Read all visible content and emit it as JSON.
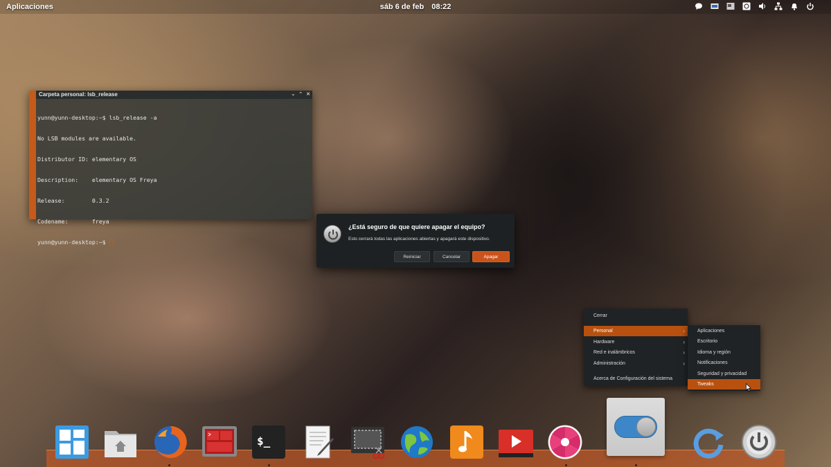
{
  "top_panel": {
    "apps_label": "Aplicaciones",
    "date": "sáb  6 de feb",
    "time": "08:22",
    "indicators": [
      "chat-icon",
      "keyboard-icon",
      "screenshot-icon",
      "steam-icon",
      "volume-icon",
      "network-icon",
      "notifications-icon",
      "power-icon"
    ]
  },
  "terminal": {
    "title": "Carpeta personal: lsb_release",
    "lines": [
      "yunn@yunn-desktop:~$ lsb_release -a",
      "No LSB modules are available.",
      "Distributor ID:\telementary OS",
      "Description:\telementary OS Freya",
      "Release:\t0.3.2",
      "Codename:\tfreya"
    ],
    "prompt": "yunn@yunn-desktop:~$ "
  },
  "shutdown_dialog": {
    "title": "¿Está seguro de que quiere apagar el equipo?",
    "message": "Esto cerrará todas las aplicaciones abiertas y apagará este dispositivo.",
    "restart_label": "Reiniciar",
    "cancel_label": "Cancelar",
    "shutdown_label": "Apagar"
  },
  "context_menu": {
    "items": [
      {
        "label": "Cerrar",
        "submenu": false
      },
      {
        "label": "Personal",
        "submenu": true,
        "active": true
      },
      {
        "label": "Hardware",
        "submenu": true
      },
      {
        "label": "Red e inalámbricos",
        "submenu": true
      },
      {
        "label": "Administración",
        "submenu": true
      },
      {
        "label": "Acerca de Configuración del sistema",
        "submenu": false
      }
    ]
  },
  "submenu": {
    "items": [
      {
        "label": "Aplicaciones"
      },
      {
        "label": "Escritorio"
      },
      {
        "label": "Idioma y región"
      },
      {
        "label": "Notificaciones"
      },
      {
        "label": "Seguridad y privacidad"
      },
      {
        "label": "Tweaks",
        "active": true
      }
    ]
  },
  "dock": {
    "items": [
      "multitasking-view-icon",
      "files-icon",
      "firefox-icon",
      "terminal-alt-icon",
      "terminal-icon",
      "text-editor-icon",
      "screenshot-tool-icon",
      "browser-icon",
      "music-icon",
      "video-icon",
      "photo-viewer-icon",
      "system-settings-icon",
      "update-icon",
      "shutdown-icon"
    ]
  },
  "colors": {
    "accent": "#c55a1a",
    "menu_bg": "#202325",
    "toggle_blue": "#3d87c8"
  }
}
